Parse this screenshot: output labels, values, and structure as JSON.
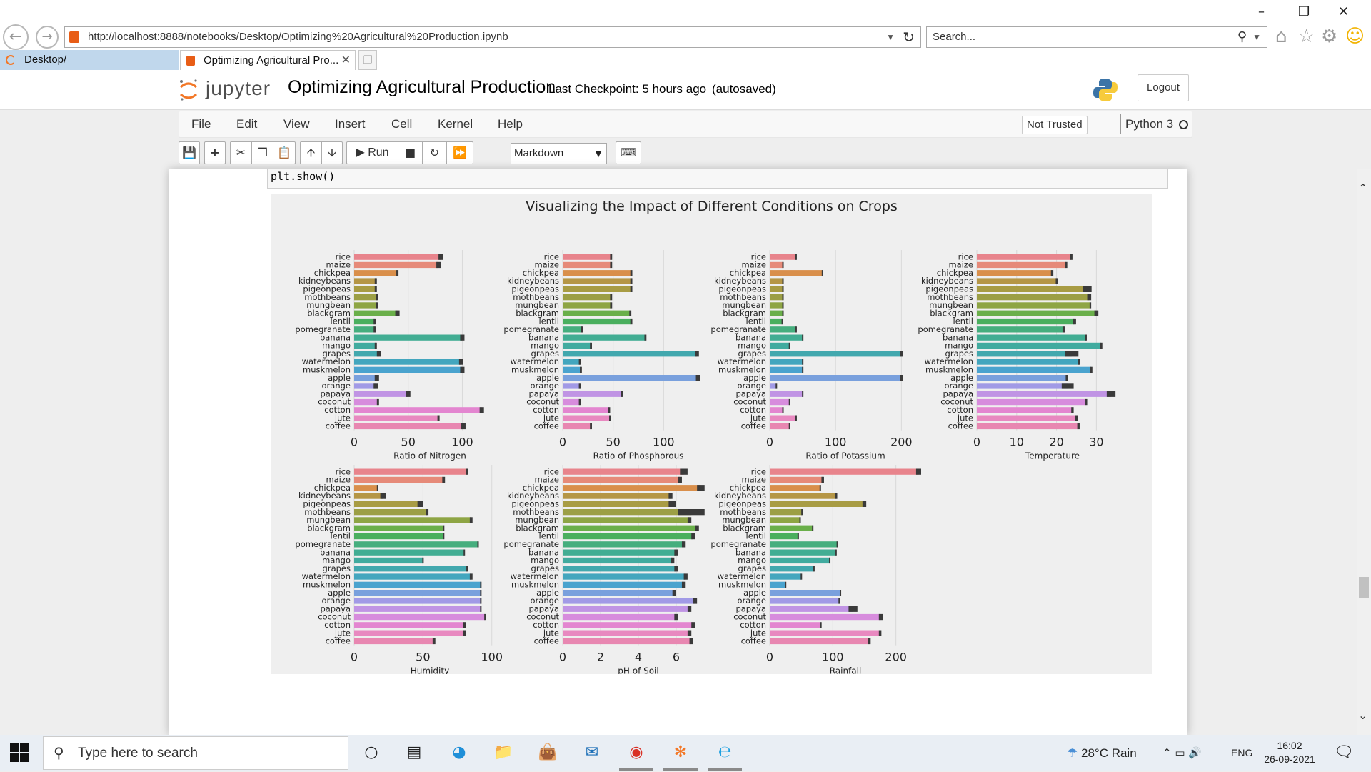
{
  "browser": {
    "url": "http://localhost:8888/notebooks/Desktop/Optimizing%20Agricultural%20Production.ipynb",
    "search_placeholder": "Search...",
    "tabs": [
      {
        "label": "Desktop/"
      },
      {
        "label": "Optimizing Agricultural Pro..."
      }
    ]
  },
  "jupyter": {
    "logo_text": "jupyter",
    "notebook_name": "Optimizing Agricultural Production",
    "checkpoint": "Last Checkpoint: 5 hours ago",
    "autosave": "(autosaved)",
    "logout": "Logout",
    "menu": [
      "File",
      "Edit",
      "View",
      "Insert",
      "Cell",
      "Kernel",
      "Help"
    ],
    "trust": "Not Trusted",
    "kernel": "Python 3",
    "toolbar": {
      "run_label": "Run",
      "cell_type": "Markdown"
    }
  },
  "code_cell": {
    "text": "plt.show()"
  },
  "chart_data": {
    "type": "bar",
    "orientation": "horizontal",
    "title": "Visualizing the Impact of Different Conditions on Crops",
    "categories": [
      "rice",
      "maize",
      "chickpea",
      "kidneybeans",
      "pigeonpeas",
      "mothbeans",
      "mungbean",
      "blackgram",
      "lentil",
      "pomegranate",
      "banana",
      "mango",
      "grapes",
      "watermelon",
      "muskmelon",
      "apple",
      "orange",
      "papaya",
      "coconut",
      "cotton",
      "jute",
      "coffee"
    ],
    "bar_colors": [
      "#e8848c",
      "#e68a79",
      "#d98f4b",
      "#b59646",
      "#a89c44",
      "#9c9f45",
      "#8ea544",
      "#6aaf4a",
      "#4aaf5e",
      "#46ae7e",
      "#42ad93",
      "#41ab9f",
      "#42a8ae",
      "#43a6be",
      "#4aa3ce",
      "#79a0dd",
      "#a19ae6",
      "#c094e4",
      "#d78cdd",
      "#e386d0",
      "#e889c0",
      "#e887b1"
    ],
    "panels": [
      {
        "xlabel": "Ratio of Nitrogen",
        "xlim": [
          0,
          140
        ],
        "ticks": [
          0,
          50,
          100
        ],
        "values": [
          80,
          78,
          40,
          20,
          20,
          21,
          21,
          40,
          19,
          19,
          100,
          20,
          23,
          99,
          100,
          21,
          20,
          50,
          22,
          118,
          78,
          101
        ],
        "errors": [
          2,
          2,
          1,
          1,
          1,
          1,
          1,
          2,
          1,
          1,
          2,
          1,
          2,
          2,
          2,
          2,
          2,
          2,
          1,
          2,
          1,
          2
        ]
      },
      {
        "xlabel": "Ratio of Phosphorous",
        "xlim": [
          0,
          150
        ],
        "ticks": [
          0,
          50,
          100
        ],
        "values": [
          48,
          48,
          68,
          68,
          68,
          48,
          48,
          67,
          68,
          19,
          82,
          28,
          133,
          17,
          18,
          134,
          17,
          59,
          17,
          46,
          47,
          28
        ],
        "errors": [
          1,
          1,
          1,
          1,
          1,
          1,
          1,
          1,
          1,
          1,
          1,
          1,
          2,
          1,
          1,
          2,
          1,
          1,
          1,
          1,
          1,
          1
        ]
      },
      {
        "xlabel": "Ratio of Potassium",
        "xlim": [
          0,
          230
        ],
        "ticks": [
          0,
          100,
          200
        ],
        "values": [
          40,
          20,
          80,
          20,
          20,
          20,
          20,
          20,
          19,
          40,
          50,
          30,
          200,
          50,
          50,
          200,
          10,
          50,
          30,
          20,
          40,
          30
        ],
        "errors": [
          1,
          1,
          1,
          1,
          1,
          1,
          1,
          1,
          1,
          1,
          1,
          1,
          2,
          1,
          1,
          2,
          1,
          1,
          1,
          1,
          1,
          1
        ]
      },
      {
        "xlabel": "Temperature",
        "xlim": [
          0,
          38
        ],
        "ticks": [
          0,
          10,
          20,
          30
        ],
        "values": [
          23.7,
          22.4,
          18.9,
          20.1,
          27.7,
          28.2,
          28.5,
          30,
          24.5,
          21.8,
          27.4,
          31.2,
          23.8,
          25.6,
          28.7,
          22.6,
          22.8,
          33.7,
          27.4,
          24,
          25,
          25.5
        ],
        "errors": [
          0.3,
          0.3,
          0.3,
          0.3,
          1.1,
          0.5,
          0.2,
          0.5,
          0.4,
          0.3,
          0.2,
          0.3,
          1.7,
          0.3,
          0.3,
          0.3,
          1.5,
          1.1,
          0.3,
          0.3,
          0.3,
          0.3
        ]
      },
      {
        "xlabel": "Humidity",
        "xlim": [
          0,
          110
        ],
        "ticks": [
          0,
          50,
          100
        ],
        "values": [
          82,
          65,
          17,
          21,
          48,
          53,
          85,
          65,
          65,
          90,
          80,
          50,
          82,
          85,
          92,
          92,
          92,
          92,
          95,
          80,
          80,
          58
        ],
        "errors": [
          1,
          1,
          0.5,
          2,
          2,
          1,
          1,
          0.5,
          0.5,
          0.5,
          0.5,
          0.5,
          0.5,
          1,
          0.5,
          0.5,
          0.5,
          0.5,
          0.5,
          1,
          1,
          1
        ]
      },
      {
        "xlabel": "pH of Soil",
        "xlim": [
          0,
          8
        ],
        "ticks": [
          0,
          2,
          4,
          6
        ],
        "values": [
          6.4,
          6.2,
          7.3,
          5.7,
          5.8,
          6.8,
          6.7,
          7.1,
          6.9,
          6.4,
          6,
          5.8,
          6,
          6.5,
          6.4,
          5.9,
          7,
          6.7,
          6,
          6.9,
          6.7,
          6.8
        ],
        "errors": [
          0.2,
          0.1,
          0.2,
          0.1,
          0.2,
          0.7,
          0.1,
          0.1,
          0.1,
          0.1,
          0.1,
          0.1,
          0.1,
          0.1,
          0.1,
          0.1,
          0.1,
          0.1,
          0.1,
          0.1,
          0.1,
          0.1
        ]
      },
      {
        "xlabel": "Rainfall",
        "xlim": [
          0,
          240
        ],
        "ticks": [
          0,
          100,
          200
        ],
        "values": [
          236,
          84,
          80,
          105,
          150,
          51,
          48,
          68,
          45,
          107,
          105,
          95,
          70,
          50,
          25,
          112,
          110,
          132,
          176,
          81,
          175,
          158
        ],
        "errors": [
          4,
          2,
          1,
          2,
          3,
          1,
          1,
          1,
          1,
          1,
          1,
          1,
          1,
          1,
          1,
          1,
          1,
          7,
          3,
          1,
          2,
          2
        ]
      }
    ]
  },
  "taskbar": {
    "search_placeholder": "Type here to search",
    "weather": "28°C  Rain",
    "lang": "ENG",
    "time": "16:02",
    "date": "26-09-2021"
  }
}
